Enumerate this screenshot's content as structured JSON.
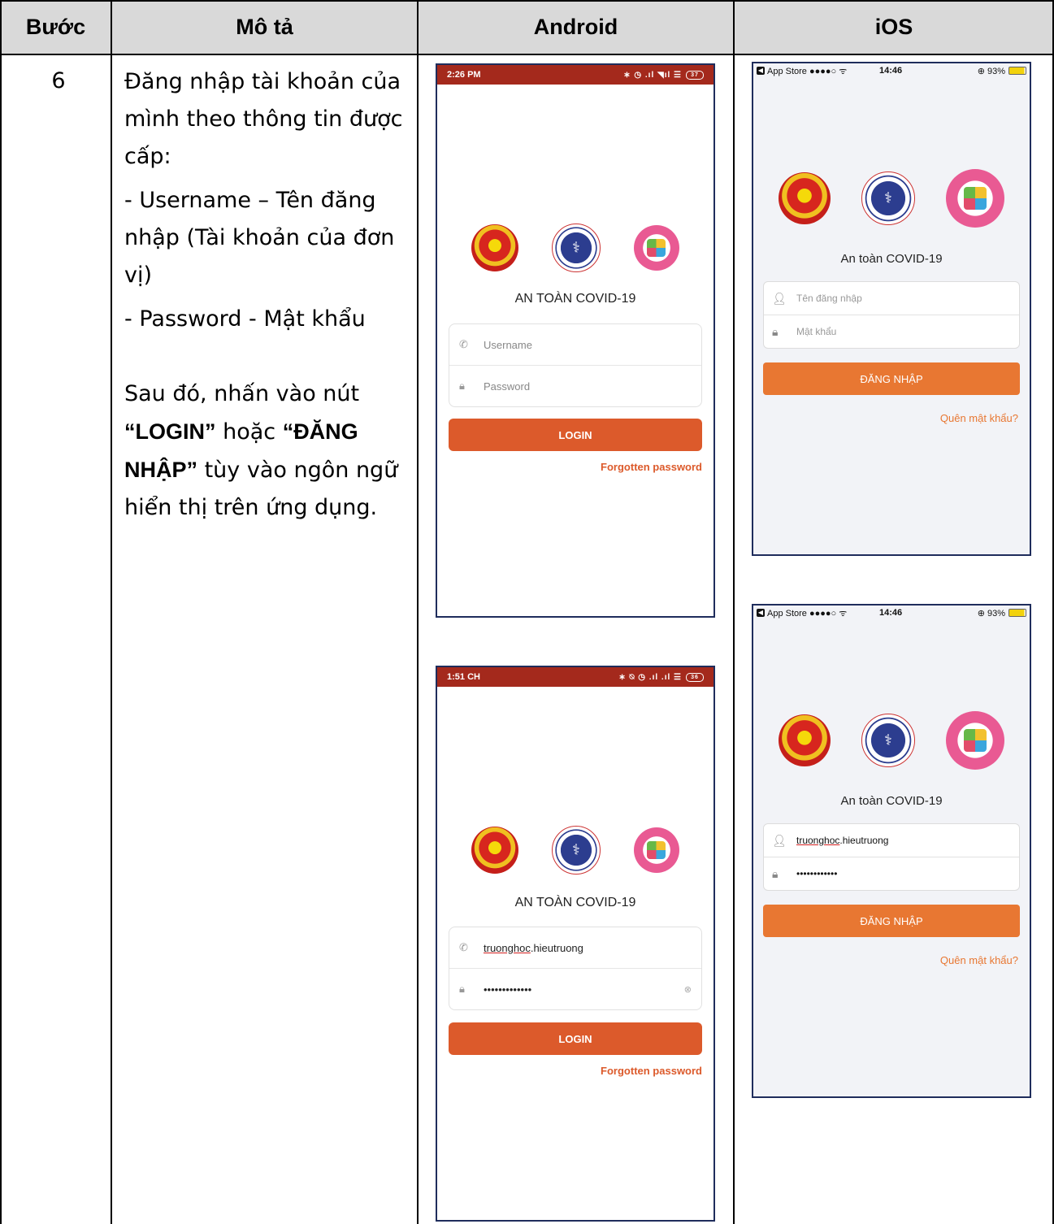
{
  "table": {
    "headers": [
      "Bước",
      "Mô tả",
      "Android",
      "iOS"
    ],
    "step": "6",
    "desc": {
      "p1": "Đăng nhập tài khoản của mình theo thông tin được cấp:",
      "p2": "- Username – Tên đăng nhập (Tài khoản của đơn vị)",
      "p3": "- Password - Mật khẩu",
      "p4_a": "Sau đó, nhấn vào nút ",
      "p4_b": "“LOGIN”",
      "p4_c": " hoặc ",
      "p4_d": "“ĐĂNG NHẬP”",
      "p4_e": " tùy vào ngôn ngữ hiển thị trên ứng dụng."
    }
  },
  "android": [
    {
      "status_time": "2:26 PM",
      "status_icons": "∗ ◷ .ıl ◥ıl ☰",
      "battery": "37",
      "app_title": "AN TOÀN COVID-19",
      "username_placeholder": "Username",
      "password_placeholder": "Password",
      "login_label": "LOGIN",
      "forgot_label": "Forgotten password"
    },
    {
      "status_time": "1:51 CH",
      "status_icons": "∗ ⍉ ◷ .ıl .ıl ☰",
      "battery": "36",
      "app_title": "AN TOÀN COVID-19",
      "username_prefix": "truonghoc",
      "username_suffix": ".hieutruong",
      "password_value": "•••••••••••••",
      "login_label": "LOGIN",
      "forgot_label": "Forgotten password"
    }
  ],
  "ios": [
    {
      "carrier": "App Store ●●●●○ ᯤ",
      "time": "14:46",
      "battery_text": "⊕ 93%",
      "app_title": "An toàn COVID-19",
      "username_placeholder": "Tên đăng nhập",
      "password_placeholder": "Mật khẩu",
      "login_label": "ĐĂNG NHẬP",
      "forgot_label": "Quên mật khẩu?"
    },
    {
      "carrier": "App Store ●●●●○ ᯤ",
      "time": "14:46",
      "battery_text": "⊕ 93%",
      "app_title": "An toàn COVID-19",
      "username_prefix": "truonghoc",
      "username_suffix": ".hieutruong",
      "password_value": "••••••••••••",
      "login_label": "ĐĂNG NHẬP",
      "forgot_label": "Quên mật khẩu?"
    }
  ]
}
